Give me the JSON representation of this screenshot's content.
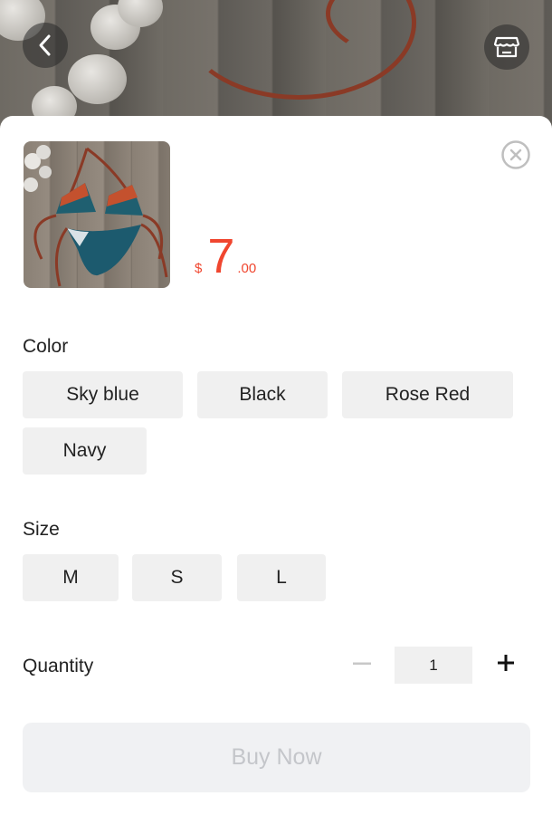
{
  "product": {
    "price": {
      "currency": "$",
      "integer": "7",
      "decimal": ".00"
    }
  },
  "color": {
    "label": "Color",
    "options": [
      "Sky blue",
      "Black",
      "Rose Red",
      "Navy"
    ]
  },
  "size": {
    "label": "Size",
    "options": [
      "M",
      "S",
      "L"
    ]
  },
  "quantity": {
    "label": "Quantity",
    "value": "1",
    "minus_icon": "minus-icon",
    "plus_icon": "plus-icon"
  },
  "buy_button": {
    "label": "Buy Now",
    "state": "disabled"
  },
  "icons": [
    "back-arrow-icon",
    "store-icon",
    "close-circle-icon"
  ],
  "colors": {
    "accent_price": "#f0462f",
    "chip_bg": "#f0f0f0",
    "buy_bg": "#f0f1f3",
    "buy_text": "#c4c6ca"
  }
}
